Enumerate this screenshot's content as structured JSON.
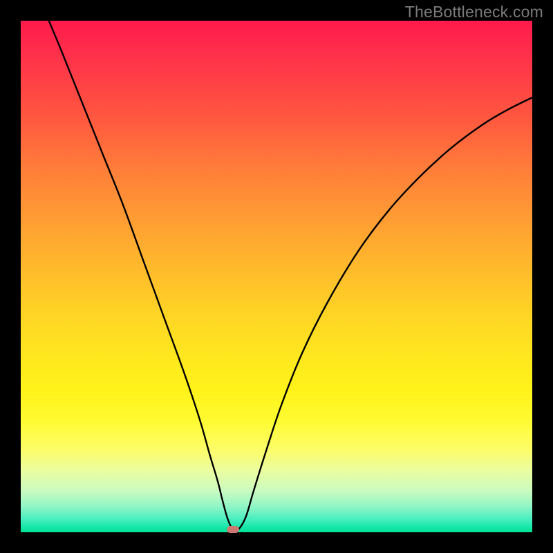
{
  "watermark": "TheBottleneck.com",
  "chart_data": {
    "type": "line",
    "title": "",
    "xlabel": "",
    "ylabel": "",
    "xlim": [
      0,
      100
    ],
    "ylim": [
      0,
      100
    ],
    "grid": false,
    "legend": false,
    "curve": {
      "name": "bottleneck-curve",
      "min_x": 41.5,
      "points": [
        {
          "x": 5.5,
          "y": 100
        },
        {
          "x": 8,
          "y": 94
        },
        {
          "x": 12,
          "y": 84
        },
        {
          "x": 16,
          "y": 74
        },
        {
          "x": 20,
          "y": 64
        },
        {
          "x": 24,
          "y": 53
        },
        {
          "x": 28,
          "y": 42
        },
        {
          "x": 32,
          "y": 31
        },
        {
          "x": 35,
          "y": 22
        },
        {
          "x": 37,
          "y": 15
        },
        {
          "x": 38.5,
          "y": 10
        },
        {
          "x": 39.5,
          "y": 6
        },
        {
          "x": 40.5,
          "y": 2.5
        },
        {
          "x": 41.5,
          "y": 0.5
        },
        {
          "x": 42.5,
          "y": 0.5
        },
        {
          "x": 44,
          "y": 3
        },
        {
          "x": 45.5,
          "y": 8
        },
        {
          "x": 48,
          "y": 16
        },
        {
          "x": 51,
          "y": 25
        },
        {
          "x": 55,
          "y": 35
        },
        {
          "x": 60,
          "y": 45
        },
        {
          "x": 66,
          "y": 55
        },
        {
          "x": 72,
          "y": 63
        },
        {
          "x": 78,
          "y": 69.5
        },
        {
          "x": 84,
          "y": 75
        },
        {
          "x": 90,
          "y": 79.5
        },
        {
          "x": 95,
          "y": 82.5
        },
        {
          "x": 100,
          "y": 85
        }
      ]
    },
    "marker": {
      "x": 41.5,
      "y": 0.6,
      "color": "#cc7a71"
    },
    "background_gradient": {
      "top": "#ff1a4b",
      "mid": "#ffd624",
      "bottom": "#00e394"
    }
  }
}
